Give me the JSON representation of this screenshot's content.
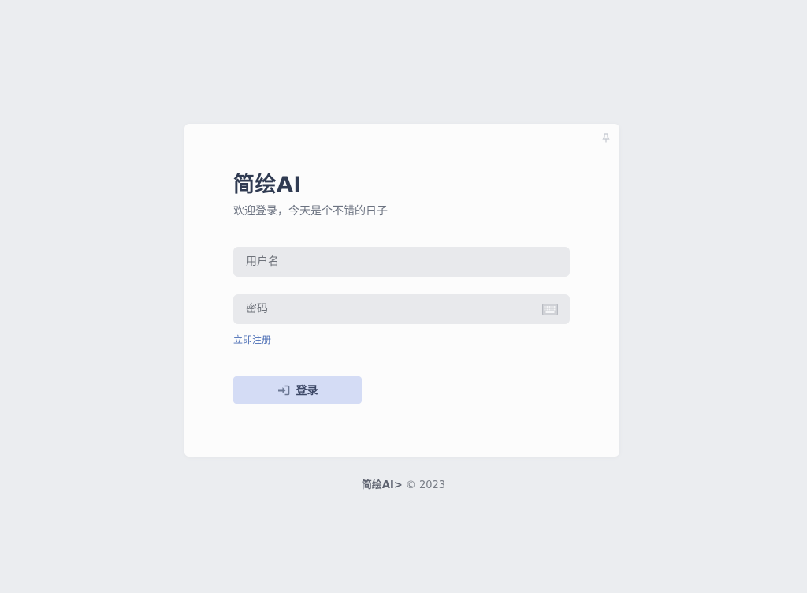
{
  "card": {
    "title": "简绘AI",
    "subtitle": "欢迎登录，今天是个不错的日子"
  },
  "form": {
    "username_placeholder": "用户名",
    "password_placeholder": "密码",
    "register_link": "立即注册",
    "login_button_label": "登录"
  },
  "icons": {
    "corner": "pin-icon",
    "password_field": "keyboard-icon",
    "login_button": "sign-in-icon"
  },
  "footer": {
    "brand": "简绘AI>",
    "copyright": "© 2023"
  },
  "colors": {
    "background": "#ebedf0",
    "card": "#fcfcfc",
    "input": "#e8e9ec",
    "primary_button": "#d4dcf5",
    "link": "#4a6db5",
    "title": "#303b52"
  }
}
